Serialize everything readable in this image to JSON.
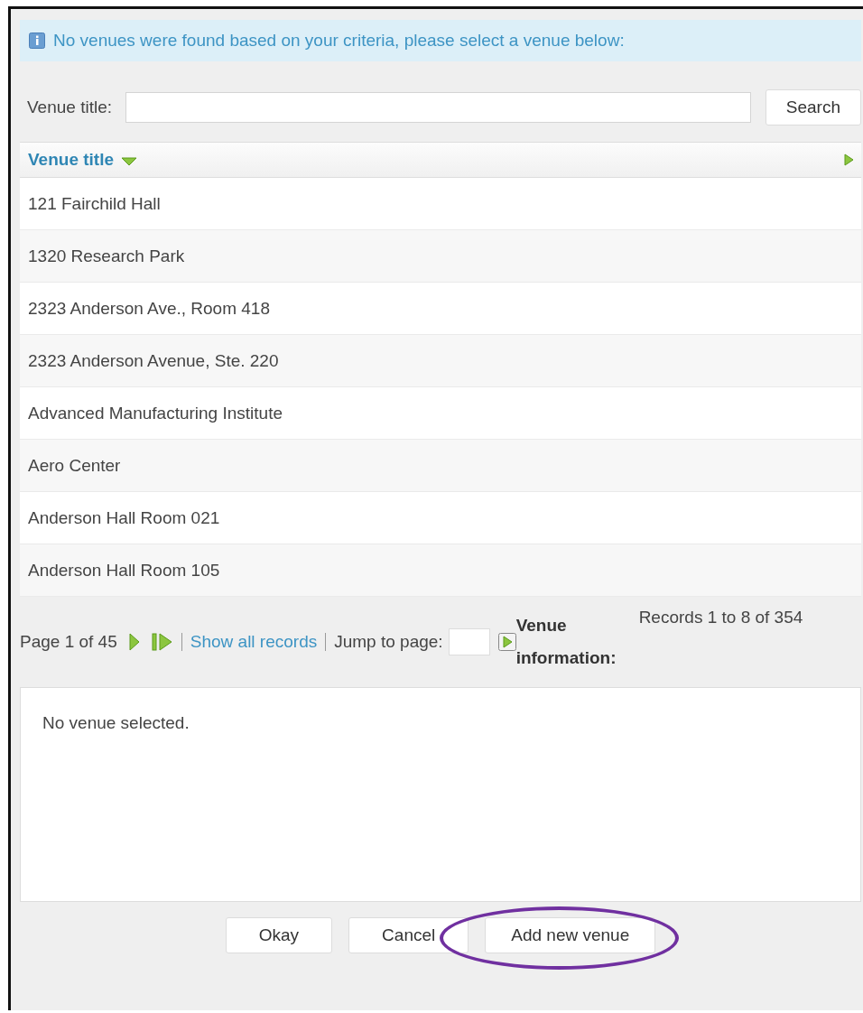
{
  "banner": {
    "text": "No venues were found based on your criteria, please select a venue below:"
  },
  "search": {
    "label": "Venue title:",
    "button": "Search"
  },
  "table": {
    "column": "Venue title",
    "rows": [
      "121 Fairchild Hall",
      "1320 Research Park",
      "2323 Anderson Ave., Room 418",
      "2323 Anderson Avenue, Ste. 220",
      "Advanced Manufacturing Institute",
      "Aero Center",
      "Anderson Hall Room 021",
      "Anderson Hall Room 105"
    ]
  },
  "pager": {
    "page": "Page 1 of 45",
    "show_all": "Show all records",
    "jump_label": "Jump to page:",
    "info_label": "Venue information:",
    "records": "Records 1 to 8 of 354"
  },
  "info": {
    "text": "No venue selected."
  },
  "buttons": [
    {
      "label": "Okay",
      "circled": false
    },
    {
      "label": "Cancel",
      "circled": false
    },
    {
      "label": "Add new venue",
      "circled": true
    }
  ]
}
